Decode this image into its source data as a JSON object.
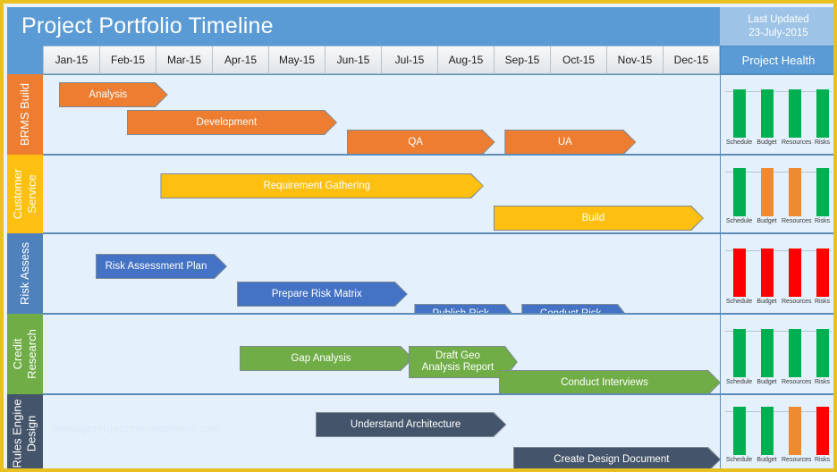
{
  "header": {
    "title": "Project Portfolio Timeline",
    "last_updated_label": "Last Updated",
    "last_updated_value": "23-July-2015",
    "project_health_label": "Project Health",
    "title_bg": "#5b9bd5",
    "last_updated_bg": "#9dc3e6",
    "border_color": "#e8c020"
  },
  "timeline": {
    "months": [
      "Jan-15",
      "Feb-15",
      "Mar-15",
      "Apr-15",
      "May-15",
      "Jun-15",
      "Jul-15",
      "Aug-15",
      "Sep-15",
      "Oct-15",
      "Nov-15",
      "Dec-15"
    ]
  },
  "health_metrics": [
    "Schedule",
    "Budget",
    "Resources",
    "Risks"
  ],
  "status_colors": {
    "green": "#00b050",
    "orange": "#ed8b33",
    "red": "#ff0000"
  },
  "watermark": "manageprojectmanagement.com",
  "lanes": [
    {
      "name": "BRMS Build",
      "color": "#ed7d31",
      "bar_color": "#ed7d31",
      "tasks": [
        {
          "label": "Analysis",
          "start": 0.3,
          "end": 2.2,
          "row": 0
        },
        {
          "label": "Development",
          "start": 1.5,
          "end": 5.2,
          "row": 1
        },
        {
          "label": "QA",
          "start": 5.4,
          "end": 8.0,
          "row": 2
        },
        {
          "label": "UA",
          "start": 8.2,
          "end": 10.5,
          "row": 2
        }
      ],
      "health": [
        "green",
        "green",
        "green",
        "green"
      ]
    },
    {
      "name": "Customer\nService",
      "color": "#fec010",
      "bar_color": "#fec010",
      "tasks": [
        {
          "label": "Requirement Gathering",
          "start": 2.1,
          "end": 7.8,
          "row": 0
        },
        {
          "label": "Build",
          "start": 8.0,
          "end": 11.7,
          "row": 1
        }
      ],
      "health": [
        "green",
        "orange",
        "orange",
        "green"
      ]
    },
    {
      "name": "Risk Assess",
      "color": "#4f81bd",
      "bar_color": "#4472c4",
      "tasks": [
        {
          "label": "Risk Assessment Plan",
          "start": 0.95,
          "end": 3.25,
          "row": 0
        },
        {
          "label": "Prepare Risk Matrix",
          "start": 3.45,
          "end": 6.45,
          "row": 1
        },
        {
          "label": "Publish Risk\nMatrix",
          "start": 6.6,
          "end": 8.4,
          "row": 2
        },
        {
          "label": "Conduct Risk\nWorkshop",
          "start": 8.5,
          "end": 10.4,
          "row": 2
        }
      ],
      "health": [
        "red",
        "red",
        "red",
        "red"
      ]
    },
    {
      "name": "Credit\nResearch",
      "color": "#70ad47",
      "bar_color": "#70ad47",
      "tasks": [
        {
          "label": "Gap Analysis",
          "start": 3.5,
          "end": 6.55,
          "row": 0
        },
        {
          "label": "Draft Geo\nAnalysis Report",
          "start": 6.5,
          "end": 8.4,
          "row": 0
        },
        {
          "label": "Conduct Interviews",
          "start": 8.1,
          "end": 12.0,
          "row": 1
        }
      ],
      "health": [
        "green",
        "green",
        "green",
        "green"
      ]
    },
    {
      "name": "Rules Engine\nDesign",
      "color": "#44546a",
      "bar_color": "#44546a",
      "tasks": [
        {
          "label": "Understand Architecture",
          "start": 4.85,
          "end": 8.2,
          "row": 0
        },
        {
          "label": "Create Design Document",
          "start": 8.35,
          "end": 12.0,
          "row": 1
        }
      ],
      "health": [
        "green",
        "green",
        "orange",
        "red"
      ]
    }
  ]
}
